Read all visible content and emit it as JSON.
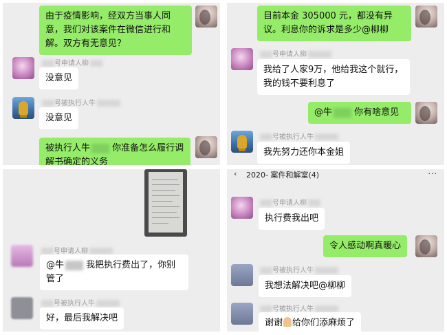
{
  "panels": {
    "p1": {
      "msgs": [
        {
          "side": "right",
          "text": "由于疫情影响，经双方当事人同意，我们对该案件在微信进行和解。双方有无意见？"
        },
        {
          "side": "left",
          "sender": "号申请人柳",
          "text": "没意见"
        },
        {
          "side": "left",
          "sender": "号被执行人牛",
          "text": "没意见"
        },
        {
          "side": "right",
          "text_a": "被执行人牛",
          "text_b": "你准备怎么履行调解书确定的义务"
        }
      ]
    },
    "p2": {
      "msgs": [
        {
          "side": "right",
          "text": "目前本金 305000 元，都没有异议。利息你的诉求是多少@柳柳"
        },
        {
          "side": "left",
          "sender": "号申请人柳",
          "text": "我给了人家9万，他给我这个就行，我的钱不要利息了"
        },
        {
          "side": "right",
          "text_a": "@牛",
          "text_b": "你有啥意见"
        },
        {
          "side": "left",
          "sender": "号被执行人牛",
          "text": "我先努力还你本金姐"
        }
      ]
    },
    "p3": {
      "msgs": [
        {
          "side": "left",
          "sender": "号申请人柳",
          "text_a": "@牛",
          "text_b": "我把执行费出了，你别管了"
        },
        {
          "side": "left",
          "sender": "号被执行人牛",
          "text": "好，最后我解决吧"
        }
      ]
    },
    "p4": {
      "header": {
        "back": "‹",
        "title": "2020-  案件和解室(4)",
        "more": "···"
      },
      "msgs": [
        {
          "side": "left",
          "sender": "号申请人柳",
          "text": "执行费我出吧"
        },
        {
          "side": "right",
          "text": "令人感动啊真暖心"
        },
        {
          "side": "left",
          "sender": "号被执行人牛",
          "text": "我想法解决吧@柳柳"
        },
        {
          "side": "left",
          "sender": "号被执行人牛",
          "text_a": "谢谢",
          "text_b": "给你们添麻烦了"
        }
      ]
    }
  }
}
